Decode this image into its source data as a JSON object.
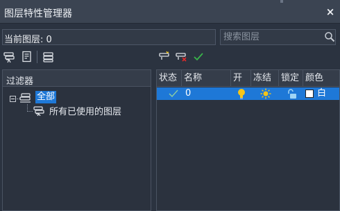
{
  "window": {
    "title": "图层特性管理器",
    "close_symbol": "×"
  },
  "current_layer": {
    "label": "当前图层: 0"
  },
  "search": {
    "placeholder": "搜索图层",
    "value": ""
  },
  "filter_panel": {
    "header": "过滤器",
    "tree": {
      "root_label": "全部",
      "root_expanded": true,
      "children": [
        {
          "label": "所有已使用的图层"
        }
      ]
    }
  },
  "layer_table": {
    "columns": [
      "状态",
      "名称",
      "开",
      "冻结",
      "锁定",
      "颜色"
    ],
    "rows": [
      {
        "status": "current-check",
        "name": "0",
        "on": "lightbulb-on-icon",
        "frozen": "sun-thawed-icon",
        "locked": "unlocked-padlock-icon",
        "color_swatch": "#ffffff",
        "color": "白",
        "selected": true
      }
    ]
  },
  "colors": {
    "selection": "#1e78d7",
    "bulb": "#f5c518",
    "accent_green": "#39b54a",
    "accent_red": "#e02a2a"
  }
}
